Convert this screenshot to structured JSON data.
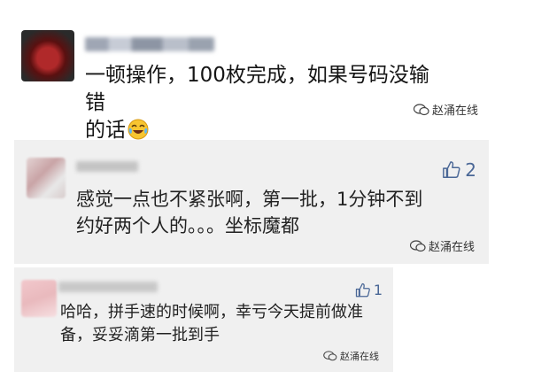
{
  "comments": [
    {
      "avatar_icon": "blurred-user-avatar",
      "text": "一顿操作，100枚完成，如果号码没输错\n的话",
      "emoji": "crying-laughing-face",
      "watermark": "赵涌在线"
    },
    {
      "avatar_icon": "blurred-user-avatar",
      "text": "感觉一点也不紧张啊，第一批，1分钟不到\n约好两个人的。。。坐标魔都",
      "likes": "2",
      "watermark": "赵涌在线"
    },
    {
      "avatar_icon": "blurred-user-avatar",
      "text": "哈哈，拼手速的时候啊，幸亏今天提前做准\n备，妥妥滴第一批到手",
      "likes": "1",
      "watermark": "赵涌在线"
    }
  ],
  "colors": {
    "reply_background": "#f0f0f0",
    "like_color": "#4a6796"
  }
}
